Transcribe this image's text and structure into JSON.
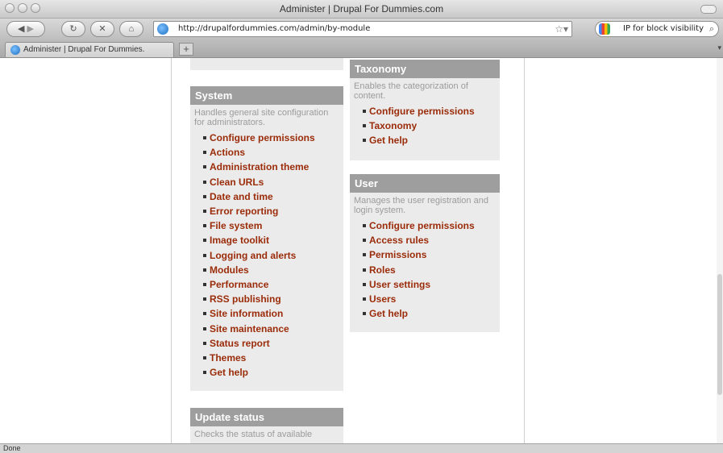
{
  "window": {
    "title": "Administer | Drupal For Dummies.com"
  },
  "toolbar": {
    "url": "http://drupalfordummies.com/admin/by-module",
    "search_text": "IP for block visibility"
  },
  "tabs": [
    {
      "label": "Administer | Drupal For Dummies."
    }
  ],
  "statusbar": {
    "text": "Done"
  },
  "panels": {
    "system": {
      "title": "System",
      "description": "Handles general site configuration for administrators.",
      "links": [
        "Configure permissions",
        "Actions",
        "Administration theme",
        "Clean URLs",
        "Date and time",
        "Error reporting",
        "File system",
        "Image toolkit",
        "Logging and alerts",
        "Modules",
        "Performance",
        "RSS publishing",
        "Site information",
        "Site maintenance",
        "Status report",
        "Themes",
        "Get help"
      ]
    },
    "taxonomy": {
      "title": "Taxonomy",
      "description": "Enables the categorization of content.",
      "links": [
        "Configure permissions",
        "Taxonomy",
        "Get help"
      ]
    },
    "user": {
      "title": "User",
      "description": "Manages the user registration and login system.",
      "links": [
        "Configure permissions",
        "Access rules",
        "Permissions",
        "Roles",
        "User settings",
        "Users",
        "Get help"
      ]
    },
    "update_status": {
      "title": "Update status",
      "description": "Checks the status of available"
    }
  },
  "colors": {
    "link": "#9b2c0a",
    "panel_header": "#9e9e9e",
    "panel_bg": "#ebebeb"
  }
}
